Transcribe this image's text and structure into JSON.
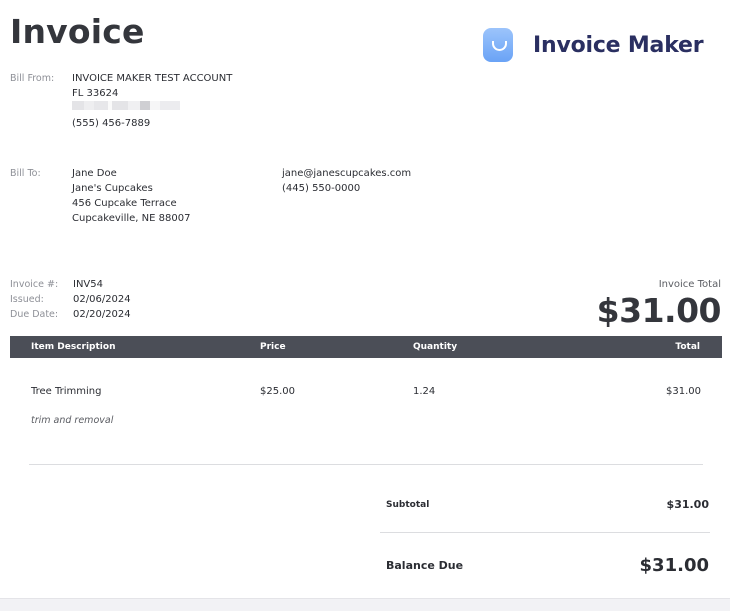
{
  "header": {
    "title": "Invoice",
    "brand_name": "Invoice Maker"
  },
  "bill_from": {
    "label": "Bill From:",
    "name": "INVOICE MAKER TEST ACCOUNT",
    "address_line": "FL 33624",
    "phone": "(555) 456-7889"
  },
  "bill_to": {
    "label": "Bill To:",
    "name": "Jane Doe",
    "company": "Jane's Cupcakes",
    "street": "456 Cupcake Terrace",
    "city": "Cupcakeville, NE 88007",
    "email": "jane@janescupcakes.com",
    "phone": "(445) 550-0000"
  },
  "meta": {
    "invoice_no_label": "Invoice #:",
    "invoice_no": "INV54",
    "issued_label": "Issued:",
    "issued": "02/06/2024",
    "due_label": "Due Date:",
    "due": "02/20/2024"
  },
  "total": {
    "label": "Invoice Total",
    "amount": "$31.00"
  },
  "table": {
    "headers": [
      "Item Description",
      "Price",
      "Quantity",
      "Total"
    ],
    "rows": [
      {
        "description": "Tree Trimming",
        "price": "$25.00",
        "quantity": "1.24",
        "total": "$31.00",
        "note": "trim and removal"
      }
    ]
  },
  "summary": {
    "subtotal_label": "Subtotal",
    "subtotal": "$31.00",
    "balance_label": "Balance Due",
    "balance": "$31.00"
  },
  "colors": {
    "table_header": "#4b4e57",
    "brand": "#2a2f61",
    "logo": "#7aaef8"
  }
}
